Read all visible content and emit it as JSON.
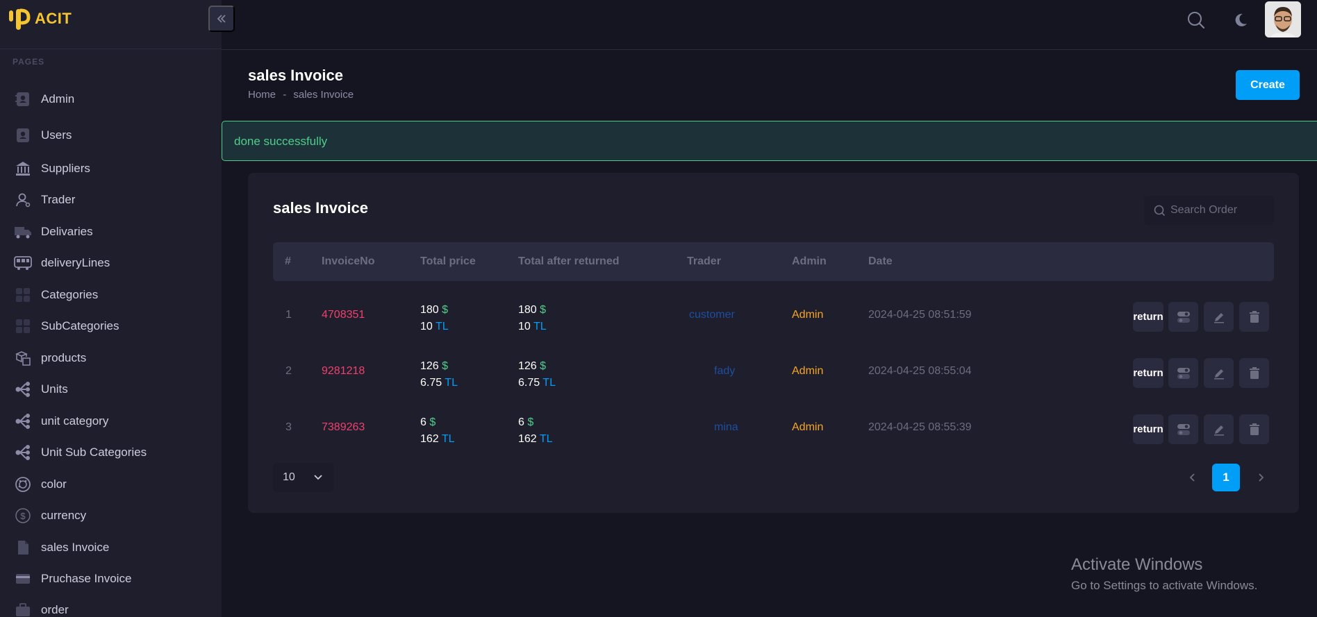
{
  "app": {
    "logo_text": "ACIT"
  },
  "sidebar": {
    "section_label": "PAGES",
    "items": [
      {
        "label": "Admin",
        "icon": "contact-book-icon"
      },
      {
        "label": "Users",
        "icon": "contact-book-icon"
      },
      {
        "label": "Suppliers",
        "icon": "bank-icon"
      },
      {
        "label": "Trader",
        "icon": "user-icon"
      },
      {
        "label": "Delivaries",
        "icon": "truck-icon"
      },
      {
        "label": "deliveryLines",
        "icon": "bus-icon"
      },
      {
        "label": "Categories",
        "icon": "grid-icon"
      },
      {
        "label": "SubCategories",
        "icon": "grid-icon"
      },
      {
        "label": "products",
        "icon": "boxes-icon"
      },
      {
        "label": "Units",
        "icon": "hierarchy-icon"
      },
      {
        "label": "unit category",
        "icon": "hierarchy-icon"
      },
      {
        "label": "Unit Sub Categories",
        "icon": "hierarchy-icon"
      },
      {
        "label": "color",
        "icon": "palette-icon"
      },
      {
        "label": "currency",
        "icon": "dollar-circle-icon"
      },
      {
        "label": "sales Invoice",
        "icon": "document-icon"
      },
      {
        "label": "Pruchase Invoice",
        "icon": "credit-card-icon"
      },
      {
        "label": "order",
        "icon": "briefcase-icon"
      }
    ]
  },
  "header": {
    "search_icon": "search-icon",
    "theme_icon": "moon-icon"
  },
  "toolbar": {
    "title": "sales Invoice",
    "breadcrumb_home": "Home",
    "breadcrumb_sep": "-",
    "breadcrumb_current": "sales Invoice",
    "create_label": "Create"
  },
  "alert": {
    "message": "done successfully"
  },
  "card": {
    "title": "sales Invoice",
    "search_placeholder": "Search Order",
    "columns": [
      "#",
      "InvoiceNo",
      "Total price",
      "Total after returned",
      "Trader",
      "Admin",
      "Date"
    ],
    "rows": [
      {
        "num": "1",
        "invoice": "4708351",
        "price_usd": "180",
        "price_tl": "10",
        "after_usd": "180",
        "after_tl": "10",
        "trader": "customer",
        "admin": "Admin",
        "date": "2024-04-25 08:51:59"
      },
      {
        "num": "2",
        "invoice": "9281218",
        "price_usd": "126",
        "price_tl": "6.75",
        "after_usd": "126",
        "after_tl": "6.75",
        "trader": "fady",
        "admin": "Admin",
        "date": "2024-04-25 08:55:04"
      },
      {
        "num": "3",
        "invoice": "7389263",
        "price_usd": "6",
        "price_tl": "162",
        "after_usd": "6",
        "after_tl": "162",
        "trader": "mina",
        "admin": "Admin",
        "date": "2024-04-25 08:55:39"
      }
    ],
    "currency_usd": "$",
    "currency_tl": "TL",
    "return_label": "return",
    "page_size": "10",
    "current_page": "1"
  },
  "watermark": {
    "title": "Activate Windows",
    "subtitle": "Go to Settings to activate Windows."
  },
  "colors": {
    "accent": "#009ef7",
    "success": "#50cd89",
    "danger": "#f1416c",
    "warning": "#f6a623"
  }
}
